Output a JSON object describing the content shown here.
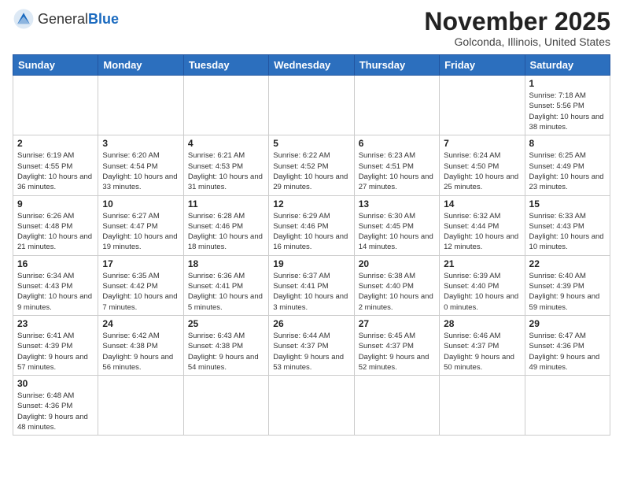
{
  "header": {
    "logo_general": "General",
    "logo_blue": "Blue",
    "month_title": "November 2025",
    "location": "Golconda, Illinois, United States"
  },
  "weekdays": [
    "Sunday",
    "Monday",
    "Tuesday",
    "Wednesday",
    "Thursday",
    "Friday",
    "Saturday"
  ],
  "weeks": [
    [
      {
        "day": "",
        "info": "",
        "empty": true
      },
      {
        "day": "",
        "info": "",
        "empty": true
      },
      {
        "day": "",
        "info": "",
        "empty": true
      },
      {
        "day": "",
        "info": "",
        "empty": true
      },
      {
        "day": "",
        "info": "",
        "empty": true
      },
      {
        "day": "",
        "info": "",
        "empty": true
      },
      {
        "day": "1",
        "info": "Sunrise: 7:18 AM\nSunset: 5:56 PM\nDaylight: 10 hours\nand 38 minutes.",
        "empty": false
      }
    ],
    [
      {
        "day": "2",
        "info": "Sunrise: 6:19 AM\nSunset: 4:55 PM\nDaylight: 10 hours\nand 36 minutes.",
        "empty": false
      },
      {
        "day": "3",
        "info": "Sunrise: 6:20 AM\nSunset: 4:54 PM\nDaylight: 10 hours\nand 33 minutes.",
        "empty": false
      },
      {
        "day": "4",
        "info": "Sunrise: 6:21 AM\nSunset: 4:53 PM\nDaylight: 10 hours\nand 31 minutes.",
        "empty": false
      },
      {
        "day": "5",
        "info": "Sunrise: 6:22 AM\nSunset: 4:52 PM\nDaylight: 10 hours\nand 29 minutes.",
        "empty": false
      },
      {
        "day": "6",
        "info": "Sunrise: 6:23 AM\nSunset: 4:51 PM\nDaylight: 10 hours\nand 27 minutes.",
        "empty": false
      },
      {
        "day": "7",
        "info": "Sunrise: 6:24 AM\nSunset: 4:50 PM\nDaylight: 10 hours\nand 25 minutes.",
        "empty": false
      },
      {
        "day": "8",
        "info": "Sunrise: 6:25 AM\nSunset: 4:49 PM\nDaylight: 10 hours\nand 23 minutes.",
        "empty": false
      }
    ],
    [
      {
        "day": "9",
        "info": "Sunrise: 6:26 AM\nSunset: 4:48 PM\nDaylight: 10 hours\nand 21 minutes.",
        "empty": false
      },
      {
        "day": "10",
        "info": "Sunrise: 6:27 AM\nSunset: 4:47 PM\nDaylight: 10 hours\nand 19 minutes.",
        "empty": false
      },
      {
        "day": "11",
        "info": "Sunrise: 6:28 AM\nSunset: 4:46 PM\nDaylight: 10 hours\nand 18 minutes.",
        "empty": false
      },
      {
        "day": "12",
        "info": "Sunrise: 6:29 AM\nSunset: 4:46 PM\nDaylight: 10 hours\nand 16 minutes.",
        "empty": false
      },
      {
        "day": "13",
        "info": "Sunrise: 6:30 AM\nSunset: 4:45 PM\nDaylight: 10 hours\nand 14 minutes.",
        "empty": false
      },
      {
        "day": "14",
        "info": "Sunrise: 6:32 AM\nSunset: 4:44 PM\nDaylight: 10 hours\nand 12 minutes.",
        "empty": false
      },
      {
        "day": "15",
        "info": "Sunrise: 6:33 AM\nSunset: 4:43 PM\nDaylight: 10 hours\nand 10 minutes.",
        "empty": false
      }
    ],
    [
      {
        "day": "16",
        "info": "Sunrise: 6:34 AM\nSunset: 4:43 PM\nDaylight: 10 hours\nand 9 minutes.",
        "empty": false
      },
      {
        "day": "17",
        "info": "Sunrise: 6:35 AM\nSunset: 4:42 PM\nDaylight: 10 hours\nand 7 minutes.",
        "empty": false
      },
      {
        "day": "18",
        "info": "Sunrise: 6:36 AM\nSunset: 4:41 PM\nDaylight: 10 hours\nand 5 minutes.",
        "empty": false
      },
      {
        "day": "19",
        "info": "Sunrise: 6:37 AM\nSunset: 4:41 PM\nDaylight: 10 hours\nand 3 minutes.",
        "empty": false
      },
      {
        "day": "20",
        "info": "Sunrise: 6:38 AM\nSunset: 4:40 PM\nDaylight: 10 hours\nand 2 minutes.",
        "empty": false
      },
      {
        "day": "21",
        "info": "Sunrise: 6:39 AM\nSunset: 4:40 PM\nDaylight: 10 hours\nand 0 minutes.",
        "empty": false
      },
      {
        "day": "22",
        "info": "Sunrise: 6:40 AM\nSunset: 4:39 PM\nDaylight: 9 hours\nand 59 minutes.",
        "empty": false
      }
    ],
    [
      {
        "day": "23",
        "info": "Sunrise: 6:41 AM\nSunset: 4:39 PM\nDaylight: 9 hours\nand 57 minutes.",
        "empty": false
      },
      {
        "day": "24",
        "info": "Sunrise: 6:42 AM\nSunset: 4:38 PM\nDaylight: 9 hours\nand 56 minutes.",
        "empty": false
      },
      {
        "day": "25",
        "info": "Sunrise: 6:43 AM\nSunset: 4:38 PM\nDaylight: 9 hours\nand 54 minutes.",
        "empty": false
      },
      {
        "day": "26",
        "info": "Sunrise: 6:44 AM\nSunset: 4:37 PM\nDaylight: 9 hours\nand 53 minutes.",
        "empty": false
      },
      {
        "day": "27",
        "info": "Sunrise: 6:45 AM\nSunset: 4:37 PM\nDaylight: 9 hours\nand 52 minutes.",
        "empty": false
      },
      {
        "day": "28",
        "info": "Sunrise: 6:46 AM\nSunset: 4:37 PM\nDaylight: 9 hours\nand 50 minutes.",
        "empty": false
      },
      {
        "day": "29",
        "info": "Sunrise: 6:47 AM\nSunset: 4:36 PM\nDaylight: 9 hours\nand 49 minutes.",
        "empty": false
      }
    ],
    [
      {
        "day": "30",
        "info": "Sunrise: 6:48 AM\nSunset: 4:36 PM\nDaylight: 9 hours\nand 48 minutes.",
        "empty": false
      },
      {
        "day": "",
        "info": "",
        "empty": true
      },
      {
        "day": "",
        "info": "",
        "empty": true
      },
      {
        "day": "",
        "info": "",
        "empty": true
      },
      {
        "day": "",
        "info": "",
        "empty": true
      },
      {
        "day": "",
        "info": "",
        "empty": true
      },
      {
        "day": "",
        "info": "",
        "empty": true
      }
    ]
  ]
}
